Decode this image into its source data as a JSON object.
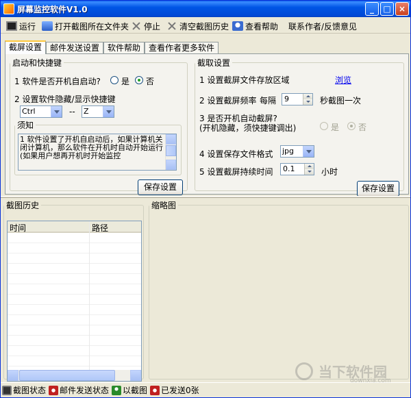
{
  "window": {
    "title": "屏幕监控软件V1.0",
    "min": "_",
    "max": "□",
    "close": "×"
  },
  "toolbar": {
    "run": "运行",
    "open_folder": "打开截图所在文件夹",
    "stop": "停止",
    "clear_history": "清空截图历史",
    "help": "查看帮助",
    "contact": "联系作者/反馈意见"
  },
  "tabs": [
    "截屏设置",
    "邮件发送设置",
    "软件帮助",
    "查看作者更多软件"
  ],
  "startup": {
    "legend": "启动和快捷键",
    "q1": "1 软件是否开机自启动?",
    "yes": "是",
    "no": "否",
    "q2": "2 设置软件隐藏/显示快捷键",
    "key1": "Ctrl",
    "sep": "--",
    "key2": "Z",
    "notice_legend": "须知",
    "notice_text": "1 软件设置了开机自启动后，如果计算机关闭计算机，那么软件在开机时自动开始运行(如果用户想再开机时开始监控",
    "save": "保存设置"
  },
  "capture": {
    "legend": "截取设置",
    "s1": "1 设置截屏文件存放区域",
    "browse": "浏览",
    "s2": "2 设置截屏频率",
    "every": "每隔",
    "interval": "9",
    "per": "秒截图一次",
    "s3a": "3 是否开机自动截屏?",
    "s3b": "(开机隐藏，须快捷键调出)",
    "yes": "是",
    "no": "否",
    "s4": "4 设置保存文件格式",
    "format": "jpg",
    "s5": "5 设置截屏持续时间",
    "duration": "0.1",
    "hours": "小时",
    "save": "保存设置"
  },
  "history": {
    "legend": "截图历史",
    "col_time": "时间",
    "col_path": "路径"
  },
  "thumbnail": {
    "legend": "缩略图"
  },
  "status": {
    "capture": "截图状态",
    "mail": "邮件发送状态",
    "captured": "以截图",
    "sent": "已发送0张"
  },
  "watermark": {
    "text": "当下软件园",
    "sub": "downxia.com"
  }
}
